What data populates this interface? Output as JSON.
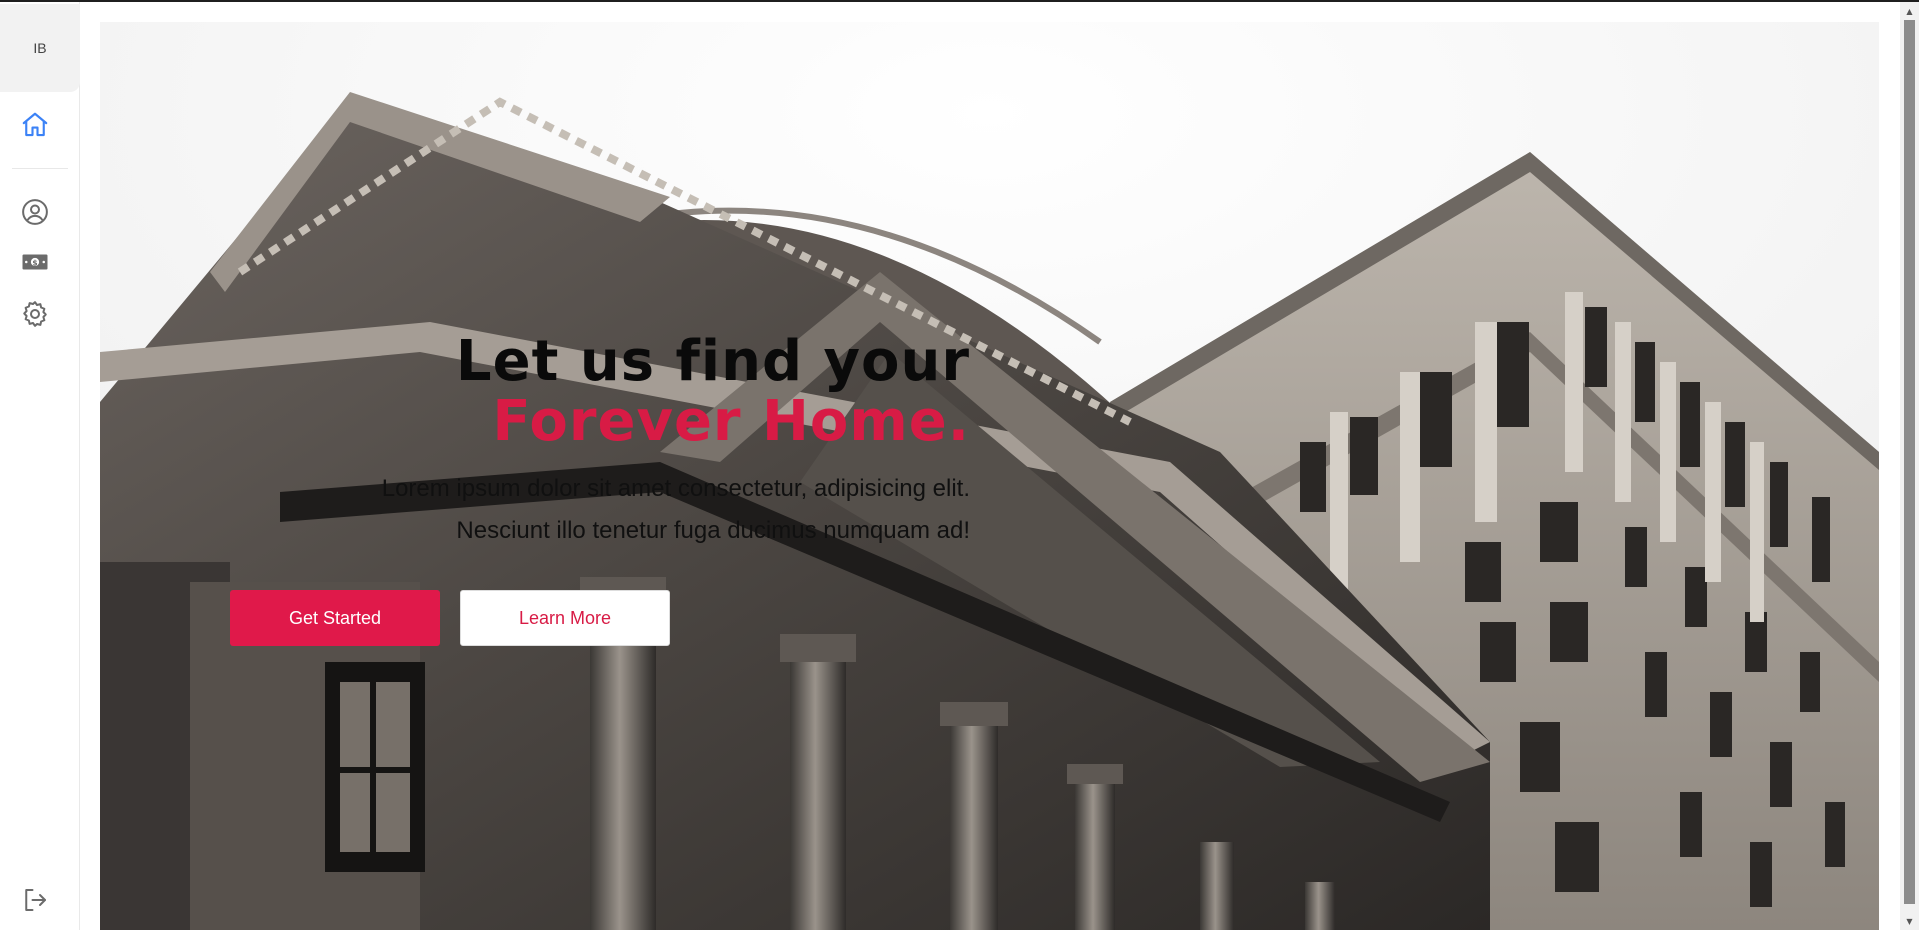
{
  "user": {
    "initials": "IB"
  },
  "sidebar": {
    "items": [
      {
        "name": "home",
        "icon": "home-icon",
        "active": true
      },
      {
        "name": "profile",
        "icon": "user-circle-icon",
        "active": false
      },
      {
        "name": "money",
        "icon": "money-icon",
        "active": false
      },
      {
        "name": "settings",
        "icon": "gear-icon",
        "active": false
      }
    ],
    "logout_icon": "logout-icon"
  },
  "hero": {
    "headline_line1": "Let us find your",
    "headline_line2": "Forever Home.",
    "lede_line1": "Lorem ipsum dolor sit amet consectetur, adipisicing elit.",
    "lede_line2": "Nesciunt illo tenetur fuga ducimus numquam ad!",
    "primary_cta": "Get Started",
    "secondary_cta": "Learn More",
    "image_icon": "building-photo"
  },
  "colors": {
    "accent": "#e0194a",
    "accent_text": "#d81b45",
    "active_icon": "#3b82f6",
    "icon": "#6b6b6b"
  }
}
